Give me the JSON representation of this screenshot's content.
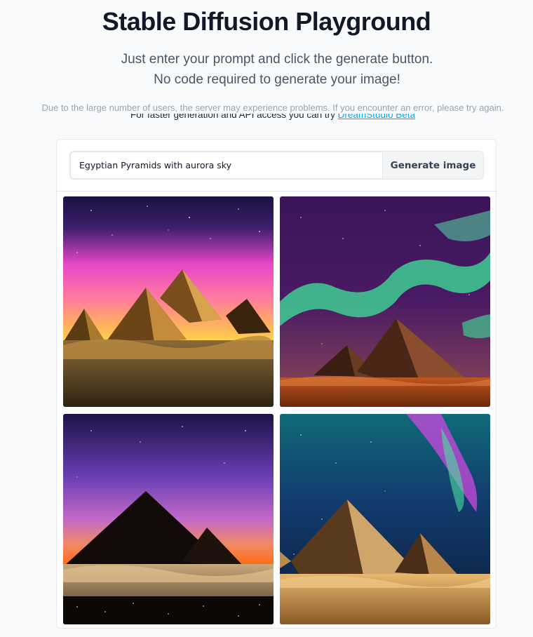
{
  "header": {
    "title": "Stable Diffusion Playground",
    "subtitle_line1": "Just enter your prompt and click the generate button.",
    "subtitle_line2": "No code required to generate your image!",
    "notice": "Due to the large number of users, the server may experience problems. If you encounter an error, please try again.",
    "faster_text": "For faster generation and API access you can try ",
    "faster_link": "DreamStudio Beta"
  },
  "form": {
    "prompt_value": "Egyptian Pyramids with aurora sky",
    "generate_label": "Generate image"
  },
  "gallery": {
    "images": [
      {
        "subject": "pyramids under pink and yellow starry sunset sky"
      },
      {
        "subject": "pyramids under green aurora at night"
      },
      {
        "subject": "pyramid silhouettes against purple orange sunset"
      },
      {
        "subject": "pyramids under purple and green aurora in blue sky"
      }
    ]
  }
}
